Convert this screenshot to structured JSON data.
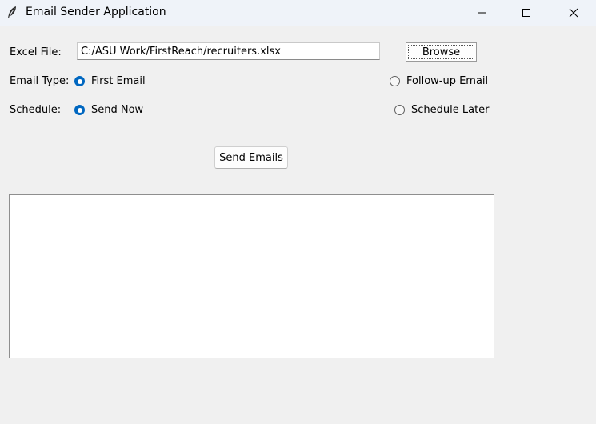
{
  "window": {
    "title": "Email Sender Application",
    "icon": "feather-icon",
    "controls": [
      "minimize-icon",
      "maximize-icon",
      "close-icon"
    ]
  },
  "file": {
    "label": "Excel File:",
    "path": "C:/ASU Work/FirstReach/recruiters.xlsx",
    "browse_label": "Browse"
  },
  "email_type": {
    "label": "Email Type:",
    "options": [
      {
        "label": "First Email",
        "selected": true
      },
      {
        "label": "Follow-up Email",
        "selected": false
      }
    ]
  },
  "schedule": {
    "label": "Schedule:",
    "options": [
      {
        "label": "Send Now",
        "selected": true
      },
      {
        "label": "Schedule Later",
        "selected": false
      }
    ]
  },
  "actions": {
    "send_label": "Send Emails"
  },
  "log": {
    "text": ""
  },
  "colors": {
    "accent": "#0067c0",
    "background": "#f0f0f0",
    "titlebar": "#eff3f9"
  }
}
